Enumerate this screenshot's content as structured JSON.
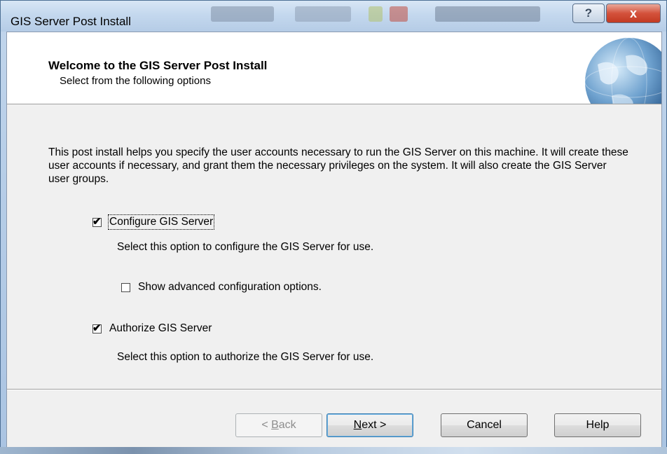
{
  "window": {
    "title": "GIS Server Post Install",
    "help_glyph": "?",
    "close_glyph": "x"
  },
  "header": {
    "title": "Welcome to the GIS Server Post Install",
    "subtitle": "Select from the following options",
    "image": "globe-icon"
  },
  "body": {
    "intro": "This post install helps you specify the user accounts necessary to run the GIS Server on this machine. It will create these user accounts if necessary, and grant them the necessary privileges on the system.  It will also create the GIS Server user groups."
  },
  "options": {
    "configure": {
      "label": "Configure GIS Server",
      "checked": true,
      "description": "Select this option to configure the GIS Server for use."
    },
    "advanced": {
      "label": "Show advanced configuration options.",
      "checked": false
    },
    "authorize": {
      "label": "Authorize GIS Server",
      "checked": true,
      "description": "Select this option to authorize the GIS Server for use."
    }
  },
  "buttons": {
    "back_prefix": "< ",
    "back_mnemonic": "B",
    "back_rest": "ack",
    "next_mnemonic": "N",
    "next_rest": "ext >",
    "cancel": "Cancel",
    "help": "Help"
  },
  "check_glyph": "✔",
  "colors": {
    "frame": "#b6cde7",
    "close_button": "#c23a22",
    "dialog_bg": "#f0f0f0"
  }
}
